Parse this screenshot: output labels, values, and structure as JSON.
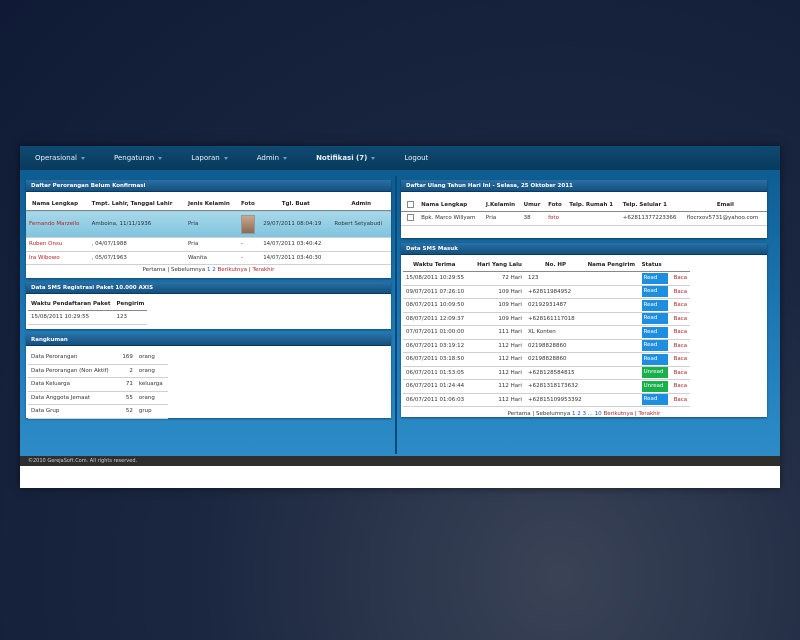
{
  "navbar": {
    "items": [
      {
        "label": "Operasional"
      },
      {
        "label": "Pengaturan"
      },
      {
        "label": "Laporan"
      },
      {
        "label": "Admin"
      },
      {
        "label": "Notifikasi (7)"
      },
      {
        "label": "Logout"
      }
    ]
  },
  "belum": {
    "title": "Daftar Perorangan Belum Konfirmasi",
    "headers": [
      "Nama Lengkap",
      "Tmpt. Lahir, Tanggal Lahir",
      "Jenis Kelamin",
      "Foto",
      "Tgl. Buat",
      "Admin"
    ],
    "rows": [
      {
        "nama": "Fernando Marzello",
        "lahir": "Amboina, 11/11/1936",
        "jk": "Pria",
        "foto": "",
        "tgl": "29/07/2011 08:04:19",
        "admin": "Robert Setyabudi"
      },
      {
        "nama": "Ruben Onsu",
        "lahir": ", 04/07/1988",
        "jk": "Pria",
        "foto": "-",
        "tgl": "14/07/2011 03:40:42",
        "admin": ""
      },
      {
        "nama": "Ira Wibowo",
        "lahir": ", 05/07/1963",
        "jk": "Wanita",
        "foto": "-",
        "tgl": "14/07/2011 03:40:30",
        "admin": ""
      }
    ],
    "pager": {
      "first": "Pertama",
      "prev": "Sebelumnya",
      "p1": "1",
      "p2": "2",
      "next": "Berikutnya",
      "last": "Terakhir"
    }
  },
  "sms_reg": {
    "title": "Data SMS Registrasi Paket 10.000 AXIS",
    "headers": [
      "Waktu Pendaftaran Paket",
      "Pengirim"
    ],
    "rows": [
      {
        "waktu": "15/08/2011 10:29:55",
        "pengirim": "123"
      }
    ]
  },
  "ringkasan": {
    "title": "Rangkuman",
    "rows": [
      {
        "label": "Data Perorangan",
        "count": "169",
        "unit": "orang"
      },
      {
        "label": "Data Perorangan (Non Aktif)",
        "count": "2",
        "unit": "orang"
      },
      {
        "label": "Data Keluarga",
        "count": "71",
        "unit": "keluarga"
      },
      {
        "label": "Data Anggota Jemaat",
        "count": "55",
        "unit": "orang"
      },
      {
        "label": "Data Grup",
        "count": "52",
        "unit": "grup"
      }
    ]
  },
  "ultah": {
    "title": "Daftar Ulang Tahun Hari Ini - Selasa, 25 Oktober 2011",
    "headers": [
      "Nama Lengkap",
      "J.Kelamin",
      "Umur",
      "Foto",
      "Telp. Rumah 1",
      "Telp. Selular 1",
      "Email"
    ],
    "rows": [
      {
        "nama": "Bpk. Marco Willyam",
        "jk": "Pria",
        "umur": "38",
        "foto": "foto",
        "rumah": "",
        "selular": "+62811377223366",
        "email": "flocrxov5731@yahoo.com"
      }
    ]
  },
  "sms_masuk": {
    "title": "Data SMS Masuk",
    "headers": [
      "Waktu Terima",
      "Hari Yang Lalu",
      "No. HP",
      "Nama Pengirim",
      "Status"
    ],
    "action": "Baca",
    "rows": [
      {
        "waktu": "15/08/2011 10:29:55",
        "lalu": "72 Hari",
        "hp": "123",
        "nama": "",
        "status": "Read"
      },
      {
        "waktu": "09/07/2011 07:26:10",
        "lalu": "109 Hari",
        "hp": "+62811984952",
        "nama": "",
        "status": "Read"
      },
      {
        "waktu": "08/07/2011 10:09:50",
        "lalu": "109 Hari",
        "hp": "02192931487",
        "nama": "",
        "status": "Read"
      },
      {
        "waktu": "08/07/2011 12:09:37",
        "lalu": "109 Hari",
        "hp": "+628161117018",
        "nama": "",
        "status": "Read"
      },
      {
        "waktu": "07/07/2011 01:00:00",
        "lalu": "111 Hari",
        "hp": "XL Konten",
        "nama": "",
        "status": "Read"
      },
      {
        "waktu": "06/07/2011 03:19:12",
        "lalu": "112 Hari",
        "hp": "02198828860",
        "nama": "",
        "status": "Read"
      },
      {
        "waktu": "06/07/2011 03:18:50",
        "lalu": "112 Hari",
        "hp": "02198828860",
        "nama": "",
        "status": "Read"
      },
      {
        "waktu": "06/07/2011 01:53:05",
        "lalu": "112 Hari",
        "hp": "+628128584815",
        "nama": "",
        "status": "Unread"
      },
      {
        "waktu": "06/07/2011 01:24:44",
        "lalu": "112 Hari",
        "hp": "+6281318173632",
        "nama": "",
        "status": "Unread"
      },
      {
        "waktu": "06/07/2011 01:06:03",
        "lalu": "112 Hari",
        "hp": "+62815109953392",
        "nama": "",
        "status": "Read"
      }
    ],
    "pager": {
      "first": "Pertama",
      "prev": "Sebelumnya",
      "p1": "1",
      "p2": "2",
      "p3": "3",
      "ell": "...",
      "p10": "10",
      "next": "Berikutnya",
      "last": "Terakhir"
    }
  },
  "footer": {
    "text": "©2010 GerejaSoft.Com. All rights reserved."
  },
  "colors": {
    "nav": "#0f4a73",
    "accent_link": "#b22222",
    "read": "#1e8fe0",
    "unread": "#18b04a",
    "highlight": "#8fcde3"
  }
}
